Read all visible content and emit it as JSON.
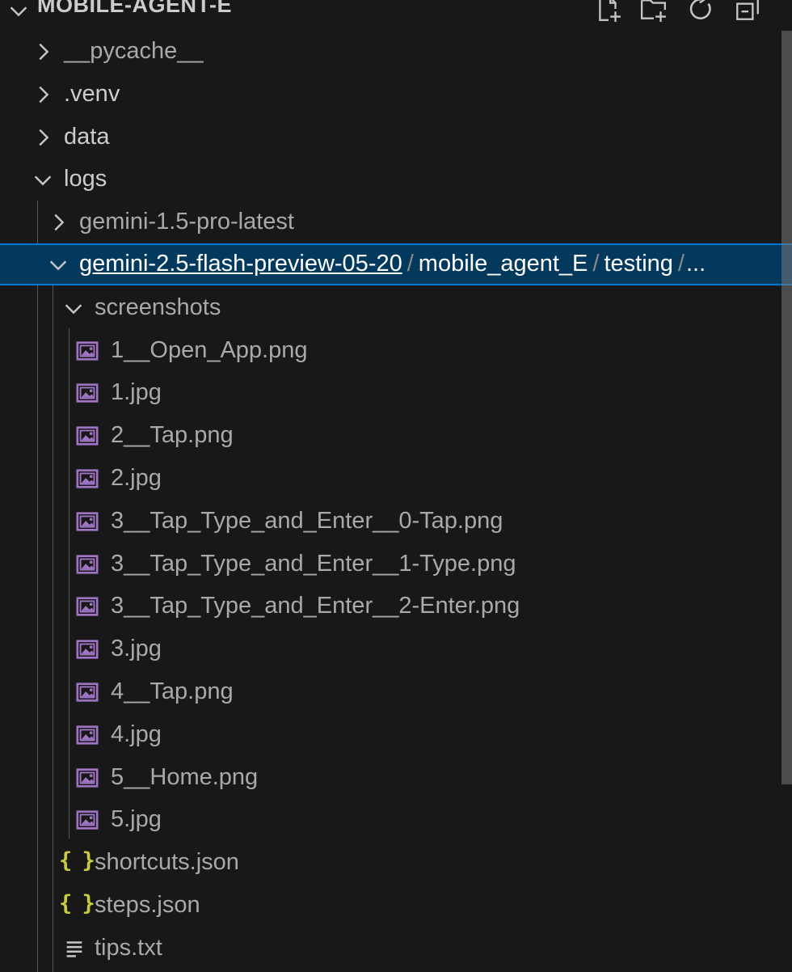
{
  "explorer": {
    "title": "MOBILE-AGENT-E",
    "actions": [
      {
        "name": "new-file-icon"
      },
      {
        "name": "new-folder-icon"
      },
      {
        "name": "refresh-icon"
      },
      {
        "name": "collapse-all-icon"
      }
    ]
  },
  "tree": {
    "pycache": "__pycache__",
    "venv": ".venv",
    "data": "data",
    "logs": "logs",
    "gemini15": "gemini-1.5-pro-latest",
    "selected_path": {
      "part1": "gemini-2.5-flash-preview-05-20",
      "sep1": "/",
      "part2": "mobile_agent_E",
      "sep2": "/",
      "part3": "testing",
      "sep3": "/",
      "ellipsis": "..."
    },
    "screenshots": "screenshots",
    "files": [
      "1__Open_App.png",
      "1.jpg",
      "2__Tap.png",
      "2.jpg",
      "3__Tap_Type_and_Enter__0-Tap.png",
      "3__Tap_Type_and_Enter__1-Type.png",
      "3__Tap_Type_and_Enter__2-Enter.png",
      "3.jpg",
      "4__Tap.png",
      "4.jpg",
      "5__Home.png",
      "5.jpg"
    ],
    "json_icon": "{ }",
    "shortcuts": "shortcuts.json",
    "steps": "steps.json",
    "tips": "tips.txt"
  },
  "colors": {
    "background": "#181818",
    "selection": "#04395e",
    "focus_border": "#0078d4",
    "image_icon": "#a074c4",
    "json_icon": "#cbcb41"
  }
}
